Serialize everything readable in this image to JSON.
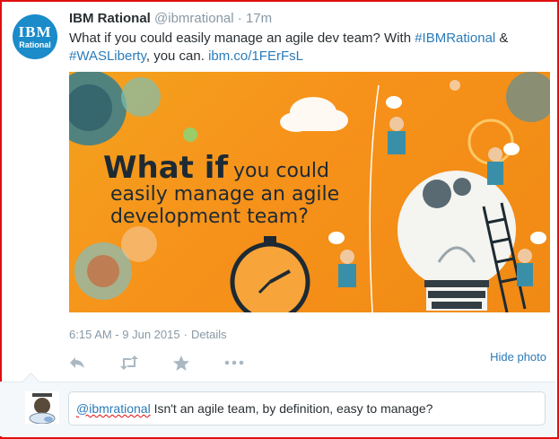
{
  "tweet": {
    "avatar": {
      "line1": "IBM",
      "line2": "Rational",
      "color": "#1b8bc9"
    },
    "author_name": "IBM Rational",
    "author_handle": "@ibmrational",
    "separator": "·",
    "time_ago": "17m",
    "text_before": "What if you could easily manage an agile dev team? With ",
    "hashtag1": "#IBMRational",
    "text_and": " &",
    "hashtag2": "#WASLiberty",
    "text_middle": ", you can. ",
    "link": "ibm.co/1FErFsL",
    "photo": {
      "headline_bold": "What if",
      "headline_rest": " you could",
      "headline_line2": "easily manage an agile",
      "headline_line3": "development team?"
    },
    "timestamp": "6:15 AM - 9 Jun 2015",
    "meta_separator": "·",
    "details_label": "Details",
    "hide_photo_label": "Hide photo",
    "actions": {
      "reply_icon": "reply-icon",
      "retweet_icon": "retweet-icon",
      "favorite_icon": "star-icon",
      "more_icon": "more-icon"
    }
  },
  "reply": {
    "mention": "@ibmrational",
    "text_rest": " Isn't an agile team, by definition, easy to manage?"
  },
  "colors": {
    "link": "#2b7bb9",
    "frame": "#e01010",
    "muted": "#8899a6"
  }
}
